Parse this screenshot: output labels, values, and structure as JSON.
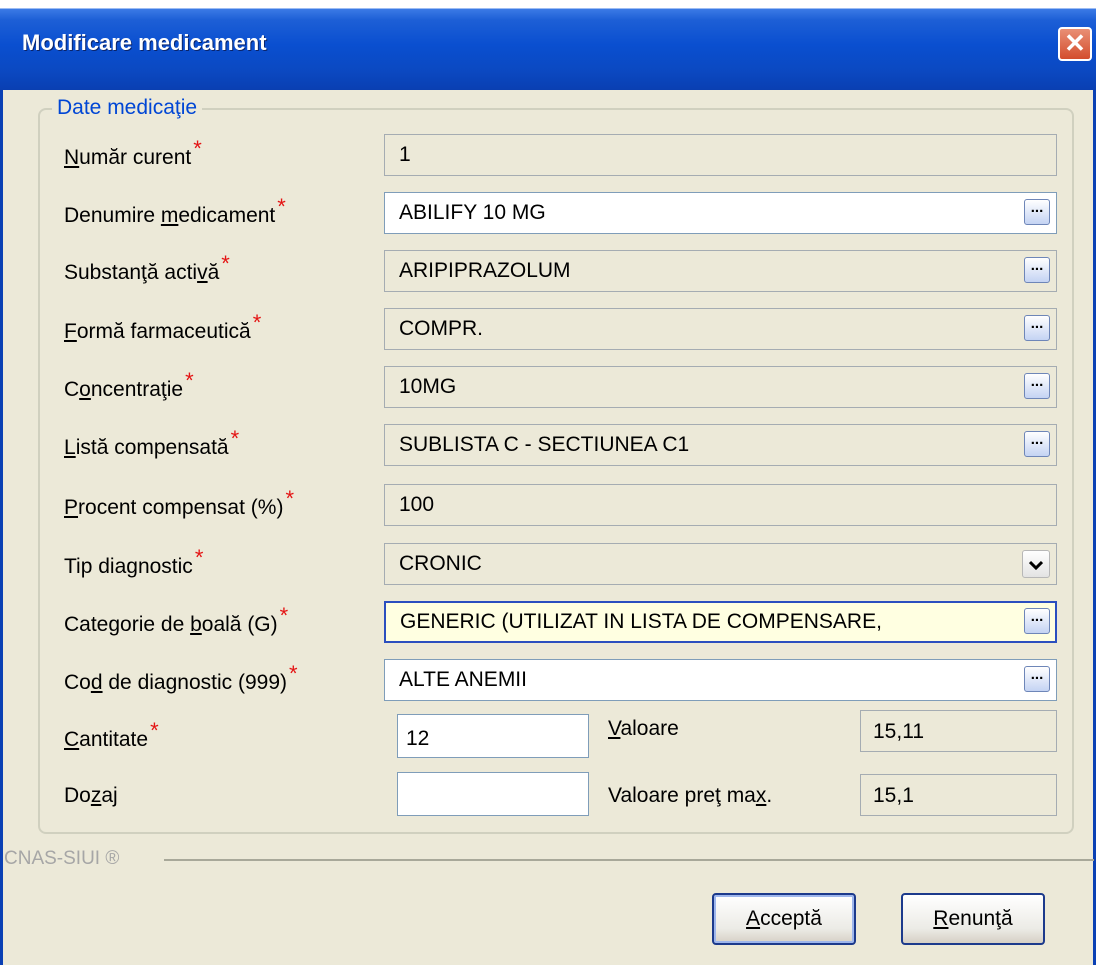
{
  "window": {
    "title": "Modificare medicament",
    "close_glyph": "✕"
  },
  "group": {
    "legend": "Date medicaţie"
  },
  "required_mark": "*",
  "fields": [
    {
      "pre": "",
      "ul": "N",
      "post": "umăr curent",
      "value": "1"
    },
    {
      "pre": "Denumire ",
      "ul": "m",
      "post": "edicament",
      "value": "ABILIFY 10 MG"
    },
    {
      "pre": "Substanţă acti",
      "ul": "v",
      "post": "ă",
      "value": "ARIPIPRAZOLUM"
    },
    {
      "pre": "",
      "ul": "F",
      "post": "ormă farmaceutică",
      "value": "COMPR."
    },
    {
      "pre": "C",
      "ul": "o",
      "post": "ncentraţie",
      "value": "10MG"
    },
    {
      "pre": "",
      "ul": "L",
      "post": "istă compensată",
      "value": "SUBLISTA C - SECTIUNEA C1"
    },
    {
      "pre": "",
      "ul": "P",
      "post": "rocent compensat (%)",
      "value": "100"
    },
    {
      "pre": "Tip dia",
      "ul": "g",
      "post": "nostic",
      "value": "CRONIC"
    },
    {
      "pre": "Categorie de ",
      "ul": "b",
      "post": "oală (G)",
      "value": "GENERIC (UTILIZAT IN LISTA DE COMPENSARE,"
    },
    {
      "pre": "Co",
      "ul": "d",
      "post": " de diagnostic (999)",
      "value": "ALTE ANEMII"
    },
    {
      "pre": "",
      "ul": "C",
      "post": "antitate",
      "value": "12"
    },
    {
      "pre": "Do",
      "ul": "z",
      "post": "aj",
      "value": ""
    }
  ],
  "valoare": {
    "pre": "",
    "ul": "V",
    "post": "aloare",
    "value": "15,11"
  },
  "valoare_pret": {
    "pre": "Valoare pre",
    "ul": "ţ",
    "post": " ma",
    "ul2": "x",
    "post2": ".",
    "value": "15,1"
  },
  "ellipsis_label": "...",
  "footer": {
    "text": "CNAS-SIUI ®"
  },
  "buttons": {
    "accept": {
      "ul": "A",
      "post": "cceptă"
    },
    "cancel": {
      "ul": "R",
      "post": "enunţă",
      "pre2": "",
      "ul2": ""
    }
  },
  "colors": {
    "accent": "#0046d5",
    "required": "#e41414",
    "titlebar": "#0a4fd0"
  }
}
